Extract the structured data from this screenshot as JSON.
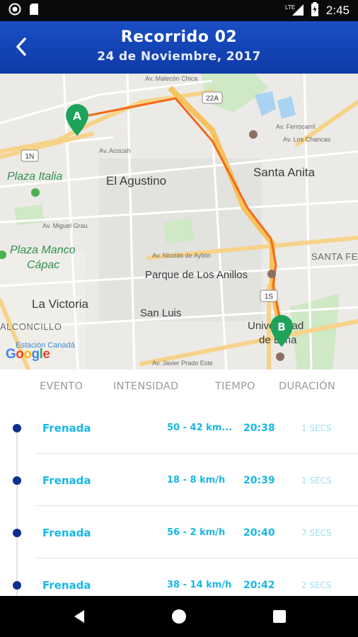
{
  "status_bar": {
    "time": "2:45",
    "network": "LTE"
  },
  "header": {
    "title": "Recorrido 02",
    "subtitle": "24 de Noviembre, 2017"
  },
  "map": {
    "labels": {
      "el_agustino": "El Agustino",
      "santa_anita": "Santa Anita",
      "plaza_italia": "Plaza Italia",
      "plaza_manco_1": "Plaza Manco",
      "plaza_manco_2": "Cápac",
      "la_victoria": "La Victoria",
      "parque": "Parque de Los Anillos",
      "san_luis": "San Luis",
      "universidad_1": "Universidad",
      "universidad_2": "de Lima",
      "santa_fel": "SANTA FEL",
      "alconcillo": "ALCONCILLO",
      "estacion": "Estación Canadá",
      "highway_22a": "22A",
      "highway_1n": "1N",
      "highway_1s": "1S",
      "street_malecon": "Av. Malecón Chica",
      "street_acocaph": "Av. Acocah",
      "street_miguel_grau": "Av. Miguel Grau",
      "street_nicolas": "Av. Nicolás de Ayllón",
      "street_ferrocarril": "Av. Ferrocarril",
      "street_los_chancas": "Av. Los Chancas",
      "street_javier_prado": "Av. Javier Prado Este"
    },
    "marker_start": "A",
    "marker_end": "B",
    "route_color": "#f26a1b",
    "marker_color": "#1fa35a"
  },
  "table": {
    "headers": {
      "event": "EVENTO",
      "intensity": "INTENSIDAD",
      "time": "TIEMPO",
      "duration": "DURACIÓN"
    },
    "rows": [
      {
        "event": "Frenada",
        "intensity": "50 - 42 km...",
        "time": "20:38",
        "duration": "1 SECS"
      },
      {
        "event": "Frenada",
        "intensity": "18 - 8 km/h",
        "time": "20:39",
        "duration": "1 SECS"
      },
      {
        "event": "Frenada",
        "intensity": "56 - 2 km/h",
        "time": "20:40",
        "duration": "7 SECS"
      },
      {
        "event": "Frenada",
        "intensity": "38 - 14 km/h",
        "time": "20:42",
        "duration": "2 SECS"
      }
    ]
  },
  "colors": {
    "app_bar": "#1a4fc4",
    "accent_text": "#19b7e6",
    "timeline_dot": "#0d2d8f"
  }
}
